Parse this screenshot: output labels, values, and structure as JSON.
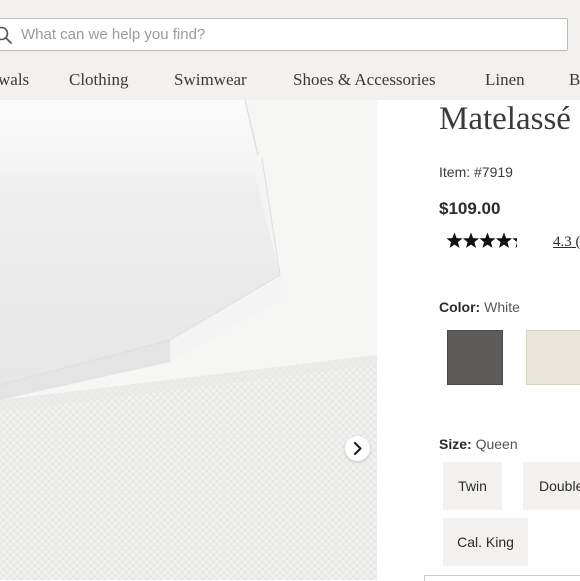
{
  "search": {
    "placeholder": "What can we help you find?"
  },
  "nav": {
    "items": [
      "wals",
      "Clothing",
      "Swimwear",
      "Shoes & Accessories",
      "Linen",
      "B"
    ]
  },
  "product": {
    "title": "Matelassé",
    "item_label": "Item:",
    "item_number": "#7919",
    "price": "$109.00",
    "rating_value": 4.3,
    "rating_text": "4.3 (",
    "color_label": "Color:",
    "color_value": "White",
    "swatches": [
      {
        "name": "Charcoal",
        "color": "#5d5c5b"
      },
      {
        "name": "White",
        "color": "#ebe6dc"
      }
    ],
    "size_label": "Size:",
    "size_value": "Queen",
    "sizes": [
      "Twin",
      "Double",
      "Cal. King"
    ]
  },
  "icons": {
    "search": "search-icon",
    "next": "chevron-right-icon",
    "star": "star-icon"
  }
}
